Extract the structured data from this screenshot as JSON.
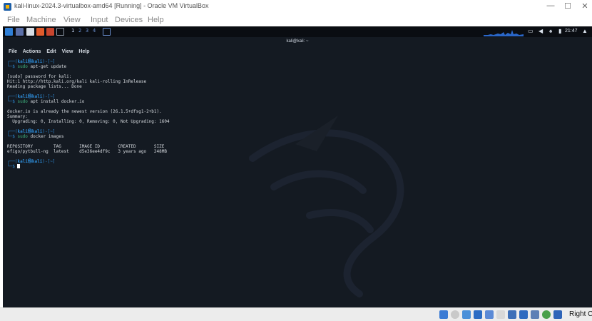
{
  "window": {
    "title": "kali-linux-2024.3-virtualbox-amd64 [Running] - Oracle VM VirtualBox",
    "controls": [
      "—",
      "☐",
      "✕"
    ]
  },
  "menu": [
    "File",
    "Machine",
    "View",
    "Input",
    "Devices",
    "Help"
  ],
  "guest_panel": {
    "workspaces": [
      "1",
      "2",
      "3",
      "4"
    ],
    "clock": "21:47",
    "accent": "#2d8bd6"
  },
  "terminal": {
    "title": "kali@kali: ~",
    "menu": [
      "File",
      "Actions",
      "Edit",
      "View",
      "Help"
    ],
    "lines": [
      {
        "kind": "prompt",
        "frame": "┌──(",
        "user": "kali㉿kali",
        "dir": ")-[~]"
      },
      {
        "kind": "command",
        "arrow": "└─$ ",
        "cmd": "sudo",
        "args": " apt-get update"
      },
      {
        "kind": "blank"
      },
      {
        "kind": "out",
        "text": "[sudo] password for kali:"
      },
      {
        "kind": "out",
        "text": "Hit:1 http://http.kali.org/kali kali-rolling InRelease"
      },
      {
        "kind": "out",
        "text": "Reading package lists... Done"
      },
      {
        "kind": "blank"
      },
      {
        "kind": "prompt",
        "frame": "┌──(",
        "user": "kali㉿kali",
        "dir": ")-[~]"
      },
      {
        "kind": "command",
        "arrow": "└─$ ",
        "cmd": "sudo",
        "args": " apt install docker.io"
      },
      {
        "kind": "blank"
      },
      {
        "kind": "out",
        "text": "docker.io is already the newest version (26.1.5+dfsg1-2+b1)."
      },
      {
        "kind": "out",
        "text": "Summary:"
      },
      {
        "kind": "out",
        "text": "  Upgrading: 0, Installing: 0, Removing: 0, Not Upgrading: 1604"
      },
      {
        "kind": "blank"
      },
      {
        "kind": "prompt",
        "frame": "┌──(",
        "user": "kali㉿kali",
        "dir": ")-[~]"
      },
      {
        "kind": "command",
        "arrow": "└─$ ",
        "cmd": "sudo",
        "args": " docker images"
      },
      {
        "kind": "blank"
      },
      {
        "kind": "out",
        "text": "REPOSITORY        TAG       IMAGE ID       CREATED       SIZE"
      },
      {
        "kind": "out",
        "text": "efigo/pytbull-ng  latest    d5e36ee4df9c   3 years ago   248MB"
      },
      {
        "kind": "blank"
      },
      {
        "kind": "prompt",
        "frame": "┌──(",
        "user": "kali㉿kali",
        "dir": ")-[~]"
      },
      {
        "kind": "cursor",
        "arrow": "└─$ "
      }
    ]
  },
  "host_taskbar": {
    "host_key_label": "Right C"
  }
}
